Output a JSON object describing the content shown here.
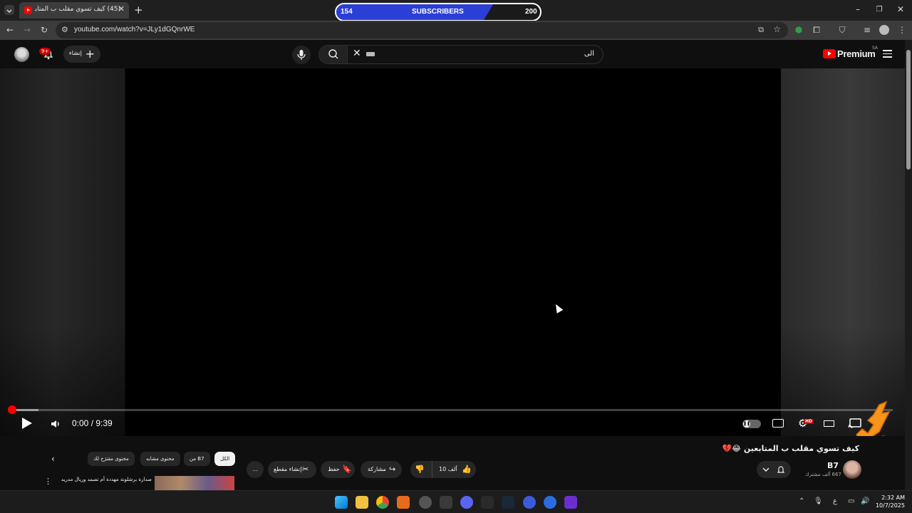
{
  "browser": {
    "tab_title": "(45) كيف تسوي مقلب ب المتابعين",
    "url": "youtube.com/watch?v=JLy1dGQnrWE"
  },
  "sub_counter": {
    "current": "154",
    "label": "SUBSCRIBERS",
    "goal": "200",
    "progress_fraction": 0.77,
    "fill_color": "#2b3fd6"
  },
  "youtube": {
    "logo_text": "Premium",
    "country_code": "SA",
    "create_label": "إنشاء",
    "notifications_badge": "9+",
    "search_query": "الى"
  },
  "player": {
    "time": "0:00 / 9:39",
    "progress_buffered_fraction": 0.03,
    "hd_badge": "HD"
  },
  "video": {
    "title": "كيف تسوي مقلب ب المتابعين 😂💔",
    "channel_name": "B7",
    "channel_subs": "667 ألف مشترك",
    "like_count": "10 ألف",
    "share_label": "مشاركة",
    "save_label": "حفظ",
    "clip_label": "إنشاء مقطع",
    "more_label": "..."
  },
  "chips": [
    {
      "label": "الكل"
    },
    {
      "label": "من B7"
    },
    {
      "label": "محتوى مشابه"
    },
    {
      "label": "محتوى مقترَح لك"
    }
  ],
  "recommendation": {
    "title": "صدارة برشلونة مهددة أم تصمد وريال مدريد"
  },
  "taskbar": {
    "time": "2:32 AM",
    "date": "10/7/2025",
    "lang": "ع"
  },
  "colors": {
    "youtube_red": "#ff0000",
    "background": "#0f0f0f",
    "chip_bg": "#272727"
  }
}
